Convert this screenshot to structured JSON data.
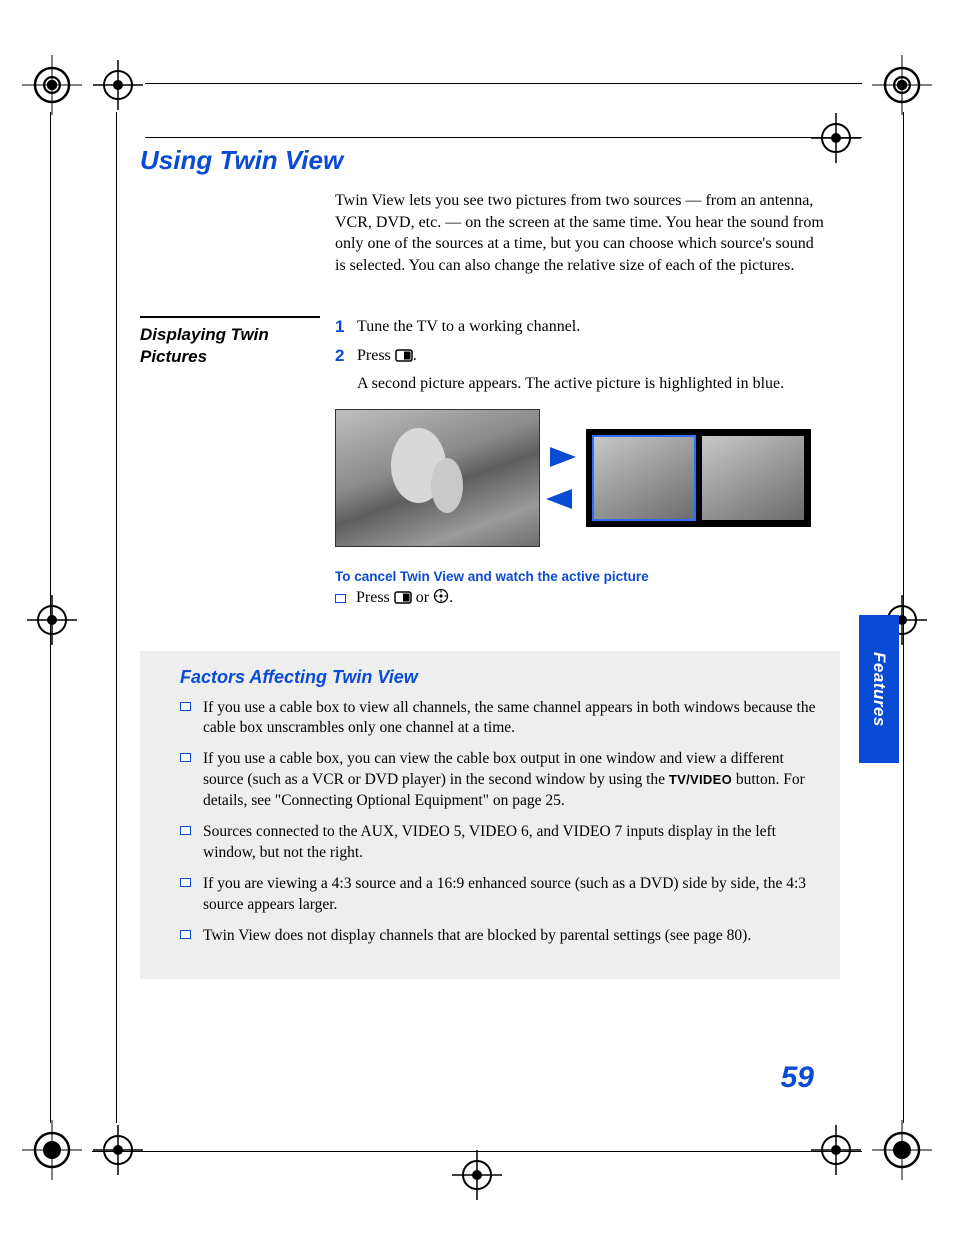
{
  "side_tab": "Features",
  "page_number": "59",
  "h1": "Using Twin View",
  "intro": "Twin View lets you see two pictures from two sources — from an antenna, VCR, DVD, etc. — on the screen at the same time. You hear the sound from only one of the sources at a time, but you can choose which source's sound is selected. You can also change the relative size of each of the pictures.",
  "displaying_heading": "Displaying Twin Pictures",
  "steps": {
    "one_num": "1",
    "one_text": "Tune the TV to a working channel.",
    "two_num": "2",
    "two_text_prefix": "Press ",
    "two_text_suffix": ".",
    "two_followup": "A second picture appears. The active picture is highlighted in blue."
  },
  "cancel": {
    "heading": "To cancel Twin View and watch the active picture",
    "text_prefix": "Press ",
    "text_middle": " or ",
    "text_suffix": "."
  },
  "factors": {
    "title": "Factors Affecting Twin View",
    "items": [
      "If you use a cable box to view all channels, the same channel appears in both windows because the cable box unscrambles only one channel at a time.",
      "If you use a cable box, you can view the cable box output in one window and view a different source (such as a VCR or DVD player) in the second window by using the TV/VIDEO button. For details, see \"Connecting Optional Equipment\" on page 25.",
      "Sources connected to the AUX, VIDEO 5, VIDEO 6, and VIDEO 7 inputs display in the left window, but not the right.",
      "If you are viewing a 4:3 source and a 16:9 enhanced source (such as a DVD) side by side, the 4:3 source appears larger.",
      "Twin View does not display channels that are blocked by parental settings (see page 80)."
    ],
    "tvvideo_label": "TV/VIDEO"
  }
}
